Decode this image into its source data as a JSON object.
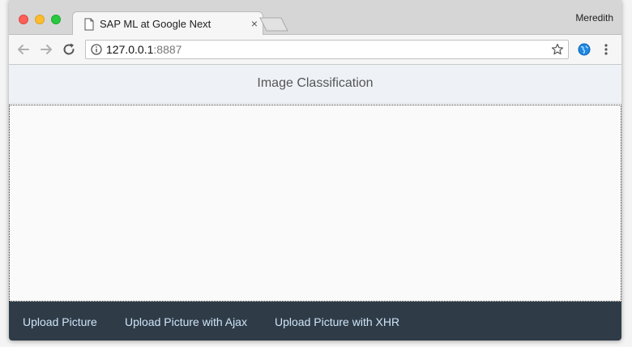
{
  "browser": {
    "tab": {
      "title": "SAP ML at Google Next",
      "close_symbol": "×"
    },
    "profile_name": "Meredith",
    "address": {
      "host": "127.0.0.1",
      "port": ":8887"
    },
    "icons": {
      "close_window": "close-window-icon",
      "minimize_window": "minimize-window-icon",
      "maximize_window": "maximize-window-icon",
      "tab_page": "page-icon",
      "back": "arrow-left-icon",
      "forward": "arrow-right-icon",
      "reload": "reload-icon",
      "info": "info-icon",
      "bookmark": "star-icon",
      "extension": "globe-extension-icon",
      "menu": "more-vertical-icon"
    },
    "colors": {
      "close": "#fc5f57",
      "minimize": "#fdbc2e",
      "maximize": "#28c840"
    }
  },
  "page": {
    "header": {
      "title": "Image Classification"
    },
    "footer": {
      "buttons": [
        {
          "label": "Upload Picture"
        },
        {
          "label": "Upload Picture with Ajax"
        },
        {
          "label": "Upload Picture with XHR"
        }
      ]
    },
    "colors": {
      "header_bg": "#eef2f6",
      "footer_bg": "#2f3c48",
      "footer_text": "#cfe4f7"
    }
  }
}
